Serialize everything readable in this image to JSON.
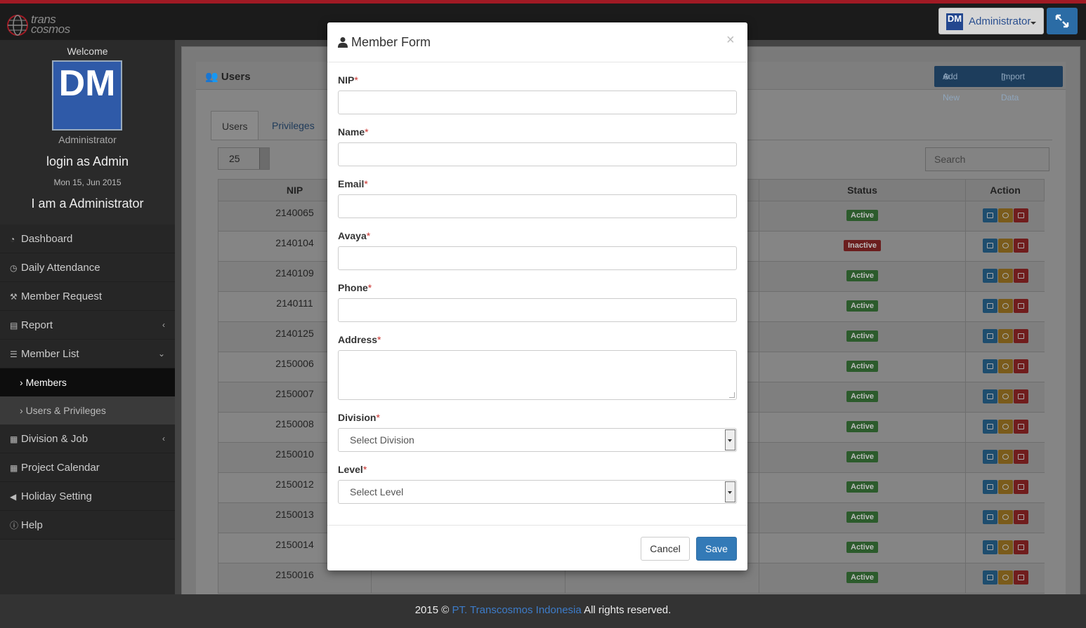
{
  "topbar": {
    "logo_text_1": "trans",
    "logo_text_2": "cosmos",
    "user_initials": "DM",
    "user_menu_label": "Administrator"
  },
  "sidebar": {
    "welcome": "Welcome",
    "avatar_initials": "DM",
    "role": "Administrator",
    "login_as": "login as Admin",
    "date": "Mon 15, Jun 2015",
    "i_am": "I am a Administrator",
    "menu": [
      {
        "label": "Dashboard",
        "icon": "dashboard-icon"
      },
      {
        "label": "Daily Attendance",
        "icon": "clock-icon"
      },
      {
        "label": "Member Request",
        "icon": "gavel-icon"
      },
      {
        "label": "Report",
        "icon": "book-icon"
      },
      {
        "label": "Member List",
        "icon": "list-icon"
      },
      {
        "label": "Members",
        "icon": "chevron-right-icon"
      },
      {
        "label": "Users & Privileges",
        "icon": "chevron-right-icon"
      },
      {
        "label": "Division & Job",
        "icon": "tasks-icon"
      },
      {
        "label": "Project Calendar",
        "icon": "calendar-icon"
      },
      {
        "label": "Holiday Setting",
        "icon": "bullhorn-icon"
      },
      {
        "label": "Help",
        "icon": "info-icon"
      }
    ]
  },
  "panel": {
    "title": "Users",
    "add_new": "Add New",
    "import_data": "Import Data",
    "tabs": [
      "Users",
      "Privileges"
    ],
    "page_size": "25",
    "search_placeholder": "Search",
    "columns": {
      "nip": "NIP",
      "status": "Status",
      "action": "Action"
    },
    "rows": [
      {
        "nip": "2140065",
        "status": "Active"
      },
      {
        "nip": "2140104",
        "status": "Inactive"
      },
      {
        "nip": "2140109",
        "status": "Active"
      },
      {
        "nip": "2140111",
        "status": "Active"
      },
      {
        "nip": "2140125",
        "status": "Active"
      },
      {
        "nip": "2150006",
        "status": "Active"
      },
      {
        "nip": "2150007",
        "status": "Active"
      },
      {
        "nip": "2150008",
        "status": "Active"
      },
      {
        "nip": "2150010",
        "status": "Active"
      },
      {
        "nip": "2150012",
        "status": "Active"
      },
      {
        "nip": "2150013",
        "status": "Active"
      },
      {
        "nip": "2150014",
        "status": "Active"
      },
      {
        "nip": "2150016",
        "status": "Active"
      }
    ]
  },
  "modal": {
    "title": "Member Form",
    "close": "×",
    "fields": {
      "nip": "NIP",
      "name": "Name",
      "email": "Email",
      "avaya": "Avaya",
      "phone": "Phone",
      "address": "Address",
      "division": "Division",
      "level": "Level"
    },
    "required_mark": "*",
    "division_placeholder": "Select Division",
    "level_placeholder": "Select Level",
    "cancel": "Cancel",
    "save": "Save"
  },
  "footer": {
    "prefix": "2015 ©",
    "company": "PT. Transcosmos Indonesia",
    "suffix": "All rights reserved."
  },
  "colors": {
    "accent": "#337ab7",
    "top_stripe": "#a01a24",
    "active_badge": "#5cb85c",
    "inactive_badge": "#d9534f"
  }
}
